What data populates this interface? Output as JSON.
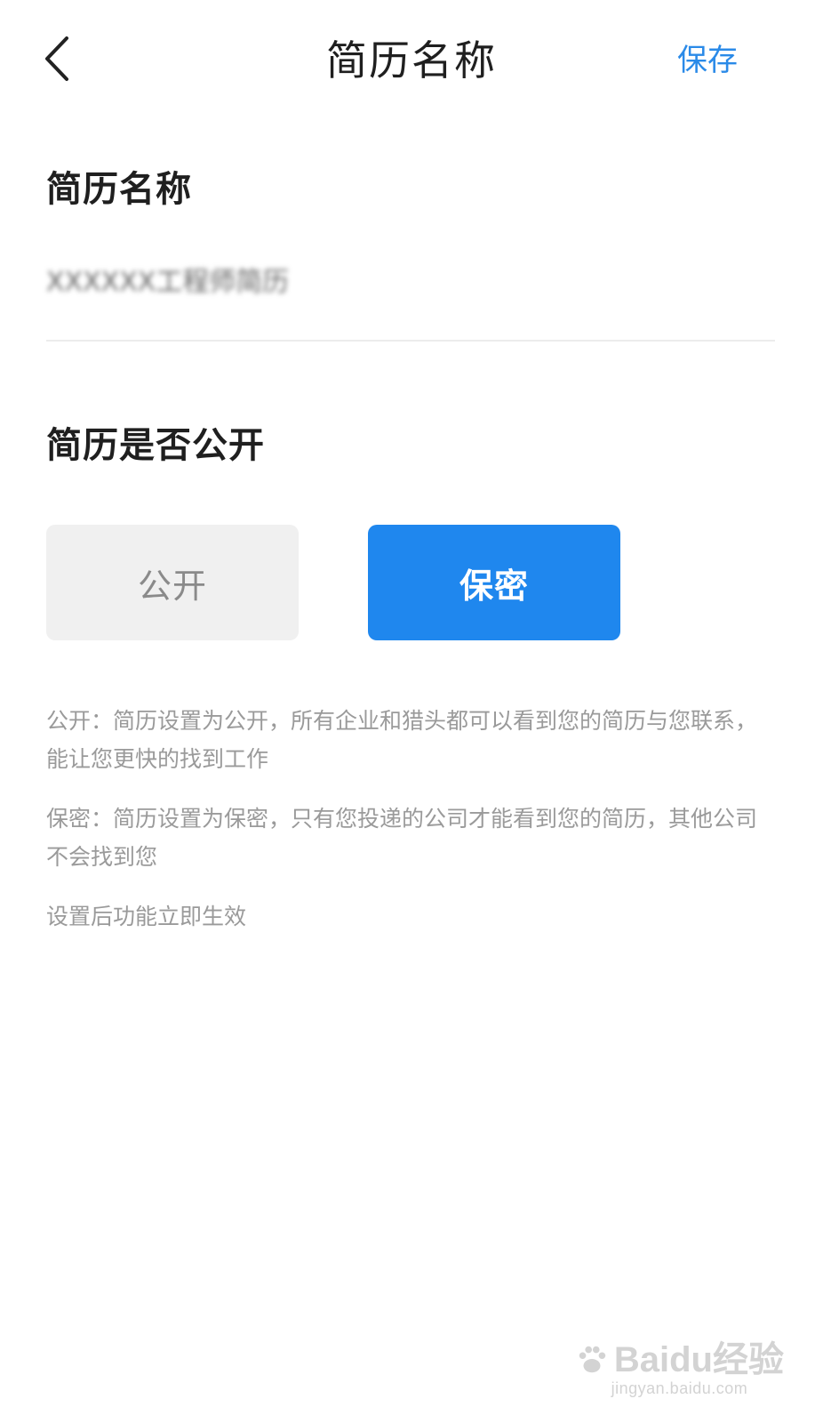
{
  "header": {
    "title": "简历名称",
    "save_label": "保存"
  },
  "name_section": {
    "label": "简历名称",
    "value": "XXXXXX工程师简历"
  },
  "public_section": {
    "label": "简历是否公开",
    "options": [
      "公开",
      "保密"
    ],
    "selected": "保密"
  },
  "descriptions": [
    "公开：简历设置为公开，所有企业和猎头都可以看到您的简历与您联系，能让您更快的找到工作",
    "保密：简历设置为保密，只有您投递的公司才能看到您的简历，其他公司不会找到您",
    "设置后功能立即生效"
  ],
  "watermark": {
    "brand": "Baidu经验",
    "url": "jingyan.baidu.com"
  },
  "colors": {
    "accent": "#1f87ee",
    "save_text": "#2a8ae8",
    "muted": "#9a9a9a"
  }
}
